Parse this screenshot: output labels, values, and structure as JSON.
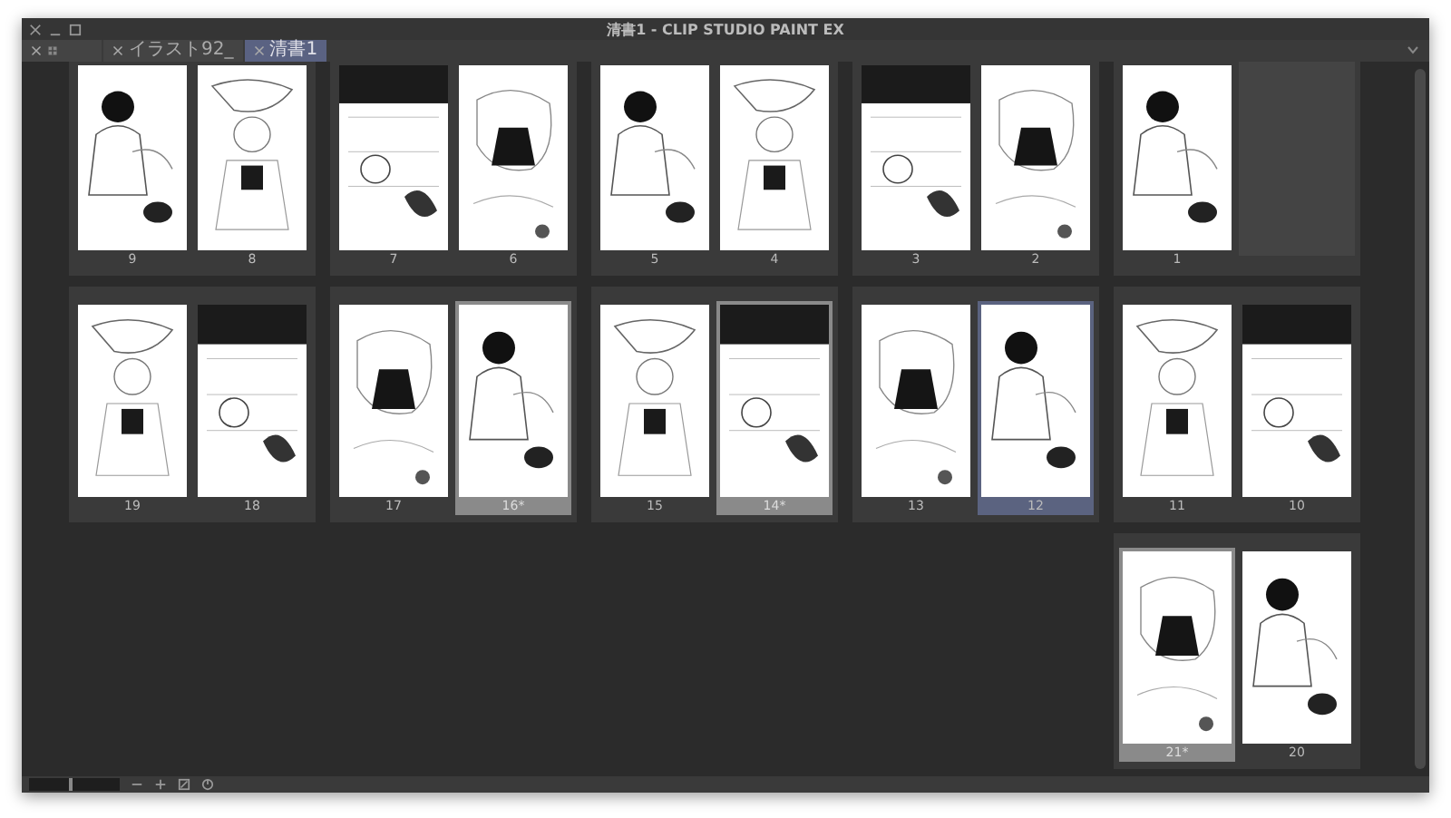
{
  "window": {
    "title": "清書1 - CLIP STUDIO PAINT EX"
  },
  "tabs": [
    {
      "selected": false
    },
    {
      "label": "イラスト92_",
      "selected": false
    },
    {
      "label": "清書1",
      "selected": true
    }
  ],
  "page_rows": [
    [
      {
        "pages": [
          {
            "number": "9",
            "modified": false,
            "selected": false
          },
          {
            "number": "8",
            "modified": false,
            "selected": false
          }
        ]
      },
      {
        "pages": [
          {
            "number": "7",
            "modified": false,
            "selected": false
          },
          {
            "number": "6",
            "modified": false,
            "selected": false
          }
        ]
      },
      {
        "pages": [
          {
            "number": "5",
            "modified": false,
            "selected": false
          },
          {
            "number": "4",
            "modified": false,
            "selected": false
          }
        ]
      },
      {
        "pages": [
          {
            "number": "3",
            "modified": false,
            "selected": false
          },
          {
            "number": "2",
            "modified": false,
            "selected": false
          }
        ]
      },
      {
        "pages": [
          {
            "number": "1",
            "modified": false,
            "selected": false
          }
        ]
      }
    ],
    [
      {
        "pages": [
          {
            "number": "19",
            "modified": false,
            "selected": false
          },
          {
            "number": "18",
            "modified": false,
            "selected": false
          }
        ]
      },
      {
        "pages": [
          {
            "number": "17",
            "modified": false,
            "selected": false
          },
          {
            "number": "16*",
            "modified": true,
            "selected": false
          }
        ]
      },
      {
        "pages": [
          {
            "number": "15",
            "modified": false,
            "selected": false
          },
          {
            "number": "14*",
            "modified": true,
            "selected": false
          }
        ]
      },
      {
        "pages": [
          {
            "number": "13",
            "modified": false,
            "selected": false
          },
          {
            "number": "12",
            "modified": false,
            "selected": true
          }
        ]
      },
      {
        "pages": [
          {
            "number": "11",
            "modified": false,
            "selected": false
          },
          {
            "number": "10",
            "modified": false,
            "selected": false
          }
        ]
      }
    ],
    [
      {
        "pages": [
          {
            "number": "21*",
            "modified": true,
            "selected": false
          },
          {
            "number": "20",
            "modified": false,
            "selected": false
          }
        ]
      }
    ]
  ],
  "zoom_slider": {
    "level": 0.45
  }
}
